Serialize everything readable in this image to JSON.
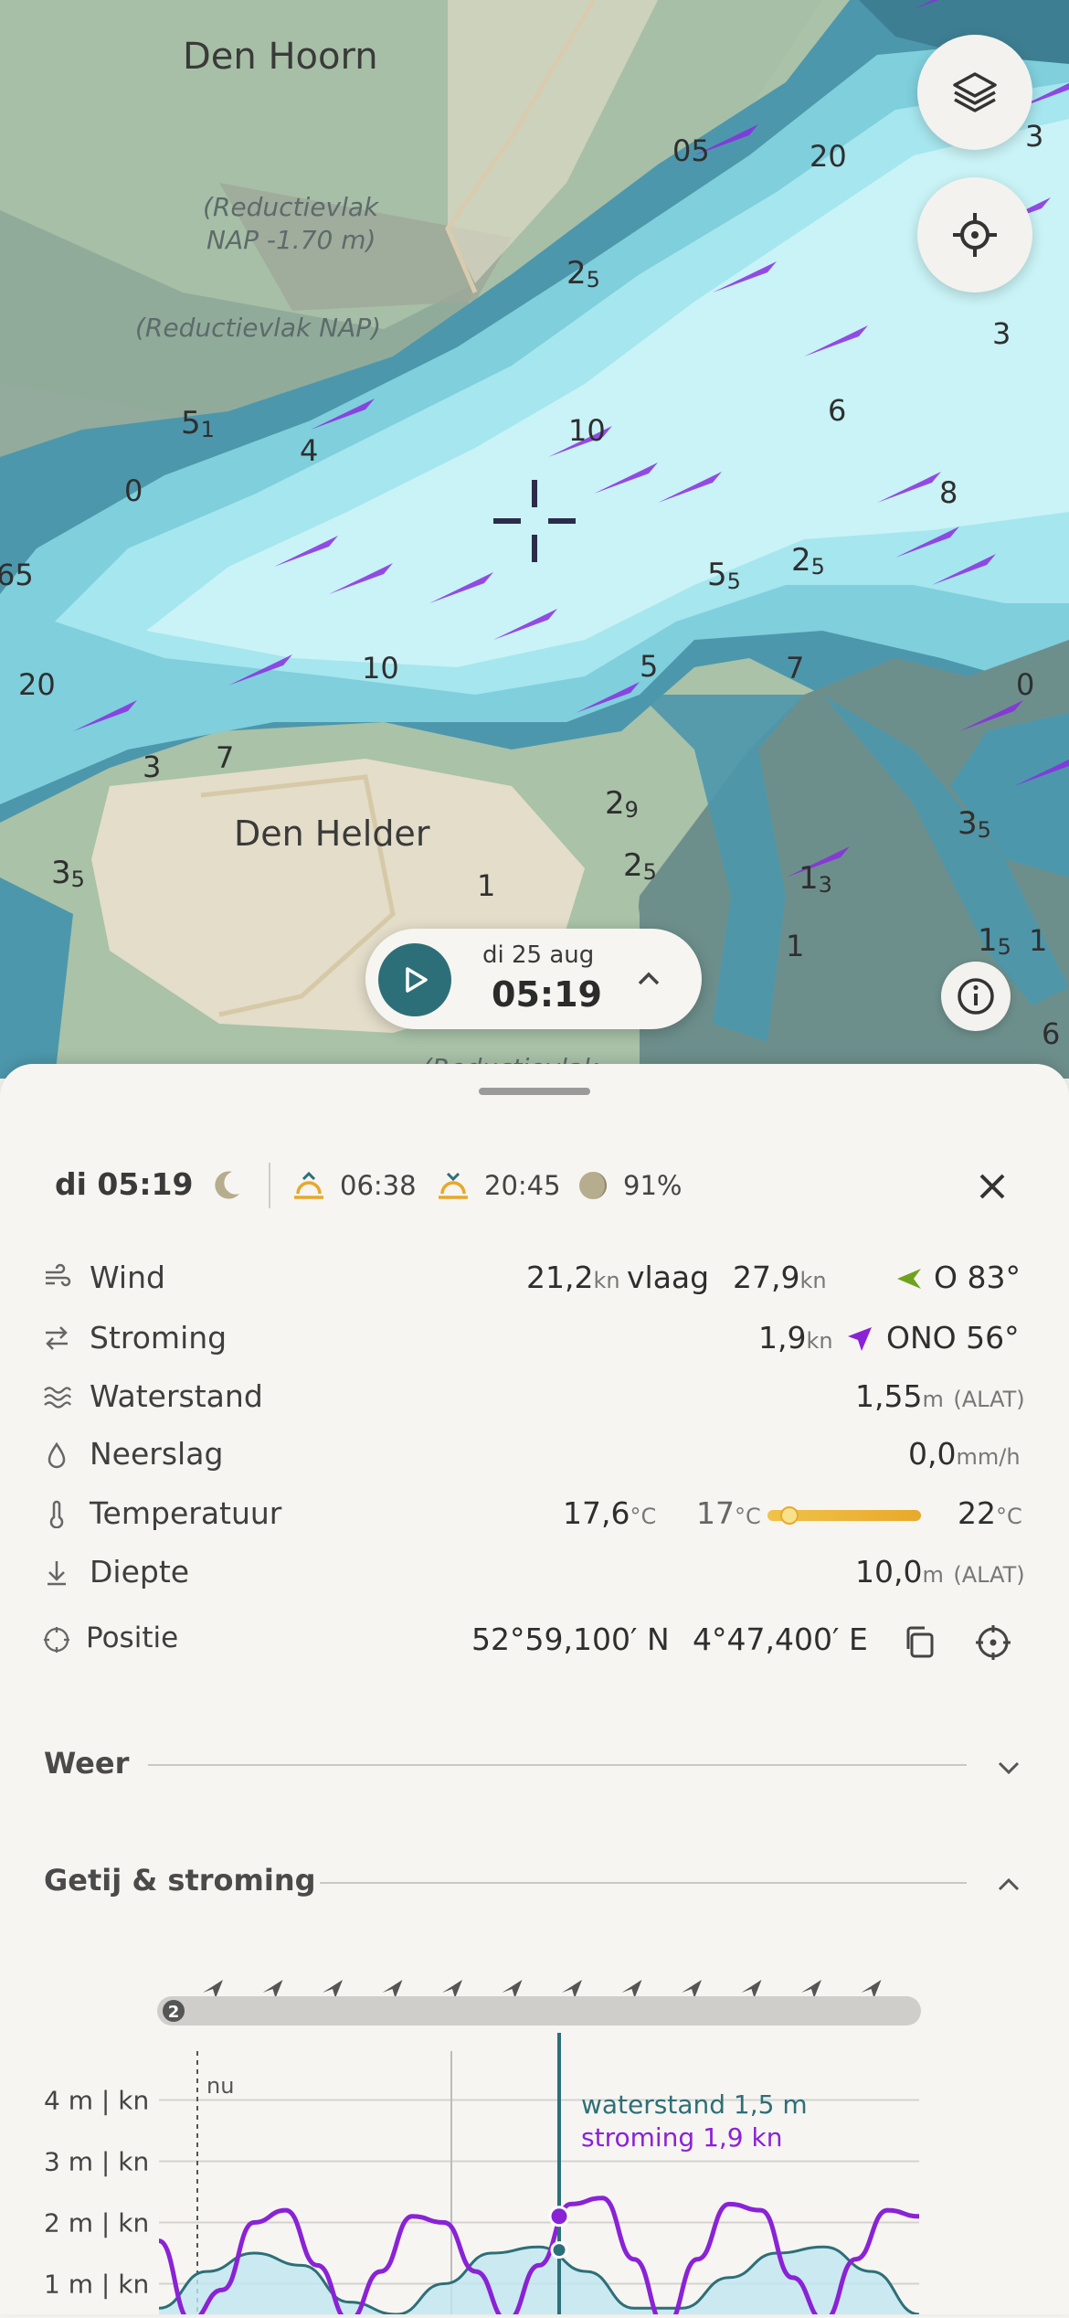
{
  "map": {
    "places": [
      "Den Hoorn",
      "Den Helder"
    ],
    "reduction_labels": [
      "(Reductievlak",
      "NAP -1.70 m)",
      "(Reductievlak NAP)",
      "(Reductievlak"
    ],
    "depths": [
      "20",
      "3",
      "3",
      "6",
      "8",
      "10",
      "10",
      "6",
      "0",
      "65",
      "20",
      "3",
      "7",
      "7",
      "5",
      "0",
      "1",
      "3",
      "1",
      "1",
      "05",
      "4"
    ],
    "depth_sub": [
      {
        "big": "2",
        "small": "5"
      },
      {
        "big": "5",
        "small": "1"
      },
      {
        "big": "5",
        "small": "5"
      },
      {
        "big": "2",
        "small": "5"
      },
      {
        "big": "2",
        "small": "9"
      },
      {
        "big": "1",
        "small": "3"
      },
      {
        "big": "3",
        "small": "5"
      },
      {
        "big": "3",
        "small": "5"
      },
      {
        "big": "2",
        "small": "5"
      },
      {
        "big": "1",
        "small": "5"
      }
    ],
    "colors": {
      "land": "#a7bfa6",
      "urban": "#e3ddc9",
      "deep_water": "#4d97ac",
      "shallow": "#c9f3f6",
      "current_arrow": "#8a2be2"
    }
  },
  "player": {
    "date": "di 25 aug",
    "time": "05:19"
  },
  "summary": {
    "day_time": "di 05:19",
    "sunrise": "06:38",
    "sunset": "20:45",
    "moon_pct": "91%"
  },
  "rows": {
    "wind": {
      "label": "Wind",
      "speed": "21,2",
      "unit": "kn",
      "gust_label": "vlaag",
      "gust": "27,9",
      "gust_unit": "kn",
      "dir": "O 83°"
    },
    "stroming": {
      "label": "Stroming",
      "speed": "1,9",
      "unit": "kn",
      "dir": "ONO 56°"
    },
    "waterstand": {
      "label": "Waterstand",
      "value": "1,55",
      "unit": "m",
      "ref": "(ALAT)"
    },
    "neerslag": {
      "label": "Neerslag",
      "value": "0,0",
      "unit": "mm/h"
    },
    "temperatuur": {
      "label": "Temperatuur",
      "value": "17,6",
      "unit": "°C",
      "min": "17",
      "min_unit": "°C",
      "max": "22",
      "max_unit": "°C"
    },
    "diepte": {
      "label": "Diepte",
      "value": "10,0",
      "unit": "m",
      "ref": "(ALAT)"
    },
    "positie": {
      "label": "Positie",
      "lat": "52°59,100′ N",
      "lon": "4°47,400′ E"
    }
  },
  "sections": {
    "weer": "Weer",
    "getij": "Getij & stroming"
  },
  "chart_data": {
    "type": "line",
    "y_tick_labels": [
      "4 m | kn",
      "3 m | kn",
      "2 m | kn",
      "1 m | kn"
    ],
    "ylim": [
      0.5,
      4.5
    ],
    "now_label": "nu",
    "cursor_labels": {
      "water": "waterstand 1,5 m",
      "current": "stroming 1,9 kn"
    },
    "day_badge": "2",
    "series": [
      {
        "values": [
          0.6,
          1.2,
          1.5,
          1.3,
          0.7,
          0.5,
          1.0,
          1.5,
          1.6,
          1.2,
          0.6,
          0.6,
          1.1,
          1.5,
          1.6,
          1.2,
          0.5
        ]
      },
      {
        "values": [
          1.7,
          0.4,
          0.9,
          2.0,
          2.2,
          1.3,
          0.4,
          1.2,
          2.1,
          2.0,
          1.2,
          0.4,
          1.3,
          2.3,
          2.4,
          1.4,
          0.3,
          1.4,
          2.3,
          2.2,
          1.1,
          0.4,
          1.4,
          2.2,
          2.1
        ]
      }
    ],
    "colors": {
      "water": "#2d6f78",
      "current": "#8a22d6",
      "fill": "#bfe6f1"
    }
  }
}
